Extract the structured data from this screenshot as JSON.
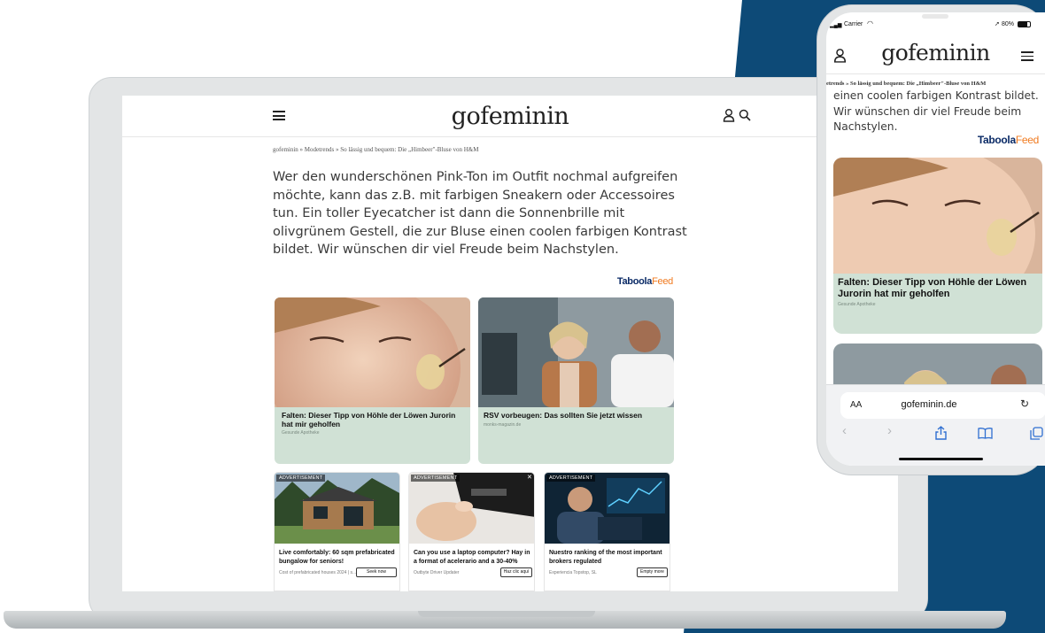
{
  "colors": {
    "navy": "#0d4a77",
    "card_green": "#d0e1d5",
    "taboola_blue": "#0a2a66",
    "taboola_orange": "#f07a1f"
  },
  "laptop": {
    "brand": "gofeminin",
    "icons": [
      "menu-icon",
      "user-icon",
      "search-icon"
    ],
    "breadcrumb": "gofeminin » Modetrends » So lässig und bequem: Die „Himbeer\"-Bluse von H&M",
    "article": "Wer den wunderschönen Pink-Ton im Outfit nochmal aufgreifen möchte, kann das z.B. mit farbigen Sneakern oder Accessoires tun. Ein toller Eyecatcher ist dann die Sonnenbrille mit olivgrünem Gestell, die zur Bluse einen coolen farbigen Kontrast bildet. Wir wünschen dir viel Freude beim Nachstylen.",
    "taboola_brand": "Taboola",
    "taboola_feed": "Feed",
    "cards": [
      {
        "title": "Falten: Dieser Tipp von Höhle der Löwen Jurorin hat mir geholfen",
        "source": "Gesunde Apotheke"
      },
      {
        "title": "RSV vorbeugen: Das sollten Sie jetzt wissen",
        "source": "monks-magazin.de"
      }
    ],
    "ads": [
      {
        "label": "ADVERTISEMENT",
        "title": "Live comfortably: 60 sqm prefabricated bungalow for seniors!",
        "source": "Cost of prefabricated houses 2024 | s...",
        "button": "Seek now"
      },
      {
        "label": "ADVERTISEMENT",
        "title": "Can you use a laptop computer? Hay in a format of acelerario and a 30-40%",
        "source": "Outbyte Driver Updater",
        "button": "Haz clic aquí"
      },
      {
        "label": "ADVERTISEMENT",
        "title": "Nuestro ranking of the most important brokers regulated",
        "source": "Experiencia Topstop, SL",
        "button": "Empty more"
      }
    ]
  },
  "phone": {
    "carrier": "Carrier",
    "battery": "80%",
    "brand": "gofeminin",
    "breadcrumb": "etrends » So lässig und bequem: Die „Himbeer\"-Bluse von H&M",
    "article": "einen coolen farbigen Kontrast bildet. Wir wünschen dir viel Freude beim Nachstylen.",
    "taboola_brand": "Taboola",
    "taboola_feed": "Feed",
    "card": {
      "title": "Falten: Dieser Tipp von Höhle der Löwen Jurorin hat mir geholfen",
      "source": "Gesunde Apotheke"
    },
    "url": "gofeminin.de",
    "aa": "AA",
    "icons": [
      "user-icon",
      "menu-icon",
      "reload-icon",
      "back-icon",
      "forward-icon",
      "share-icon",
      "bookmarks-icon",
      "tabs-icon"
    ]
  }
}
